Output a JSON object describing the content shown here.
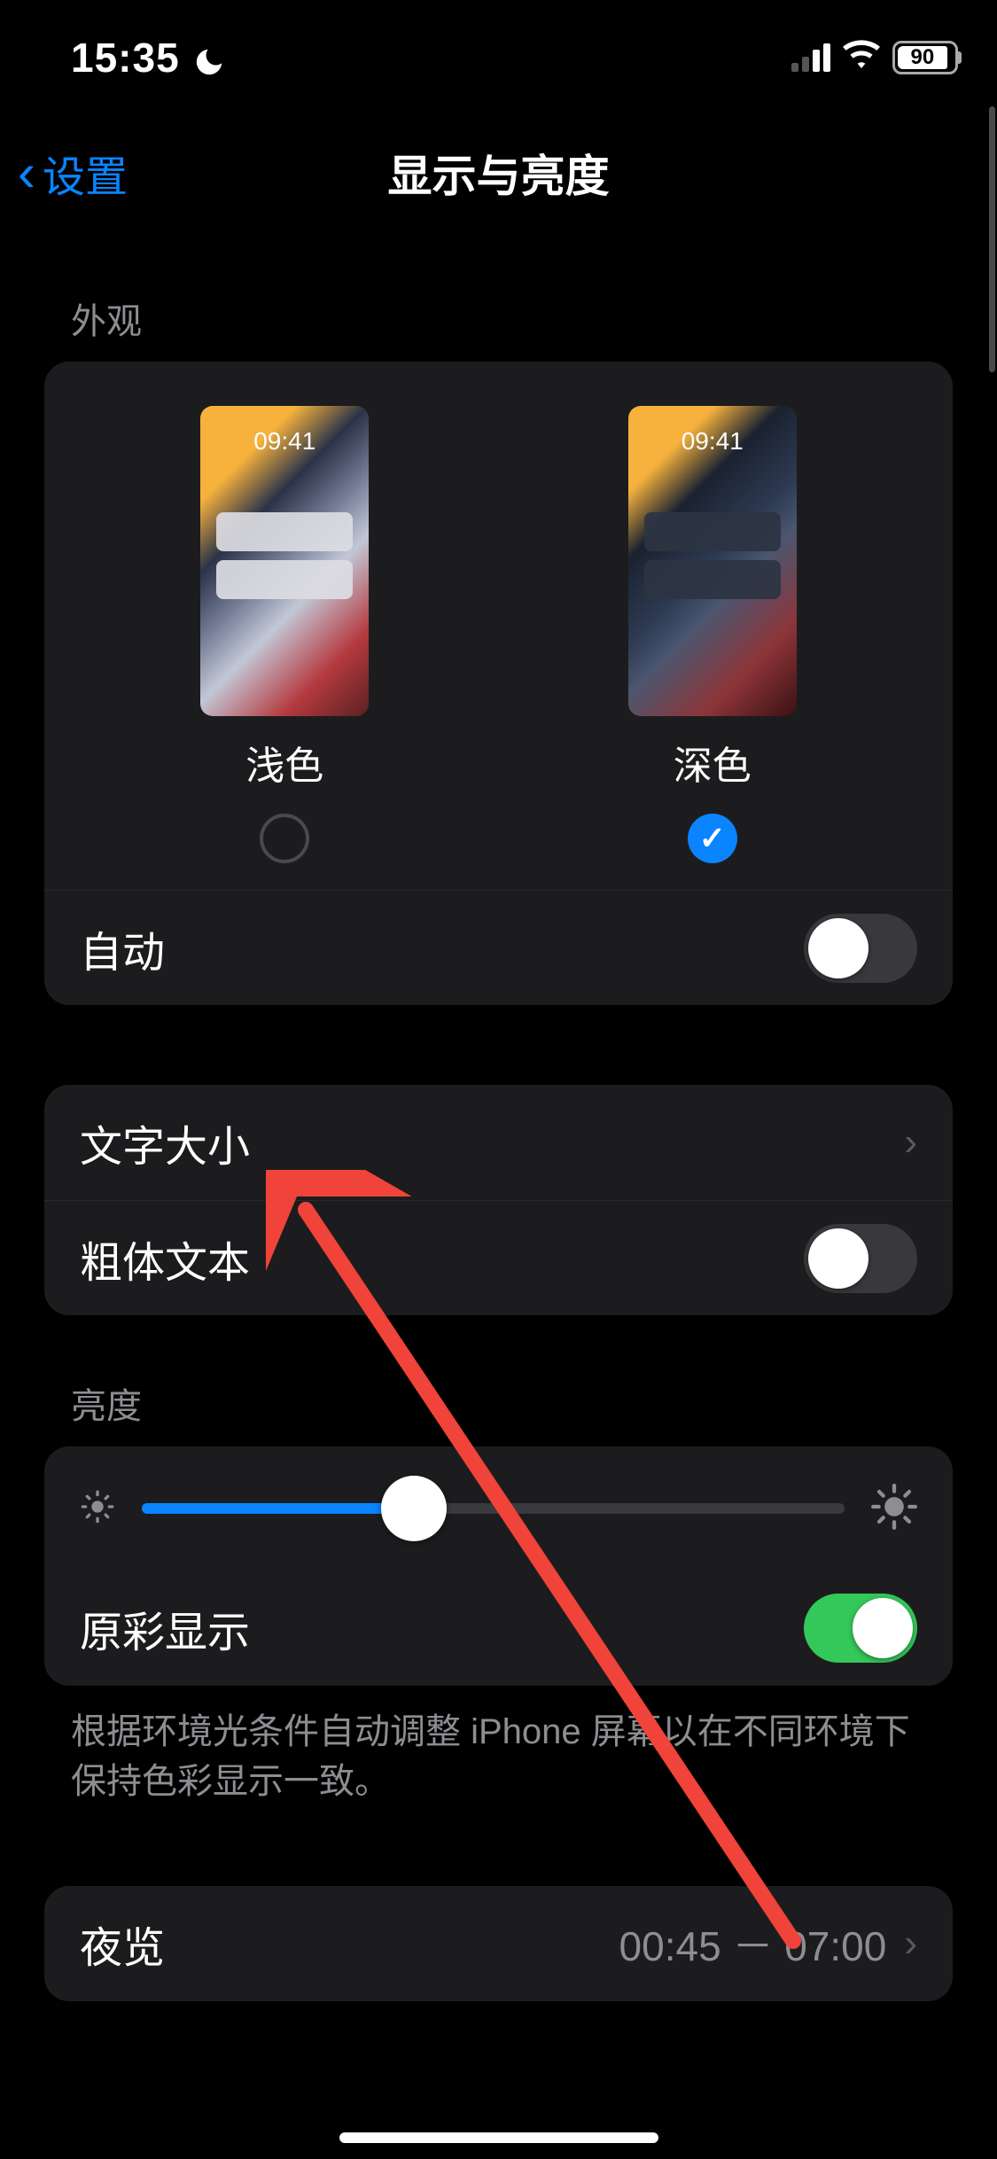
{
  "statusbar": {
    "time": "15:35",
    "battery_pct": "90"
  },
  "nav": {
    "back": "设置",
    "title": "显示与亮度"
  },
  "appearance": {
    "header": "外观",
    "preview_time": "09:41",
    "light_label": "浅色",
    "dark_label": "深色",
    "selected": "dark",
    "auto_label": "自动",
    "auto_on": false
  },
  "text": {
    "text_size_label": "文字大小",
    "bold_label": "粗体文本",
    "bold_on": false
  },
  "brightness": {
    "header": "亮度",
    "value_pct": 36,
    "true_tone_label": "原彩显示",
    "true_tone_on": true,
    "footer": "根据环境光条件自动调整 iPhone 屏幕以在不同环境下保持色彩显示一致。"
  },
  "night_shift": {
    "label": "夜览",
    "detail": "00:45 － 07:00"
  }
}
